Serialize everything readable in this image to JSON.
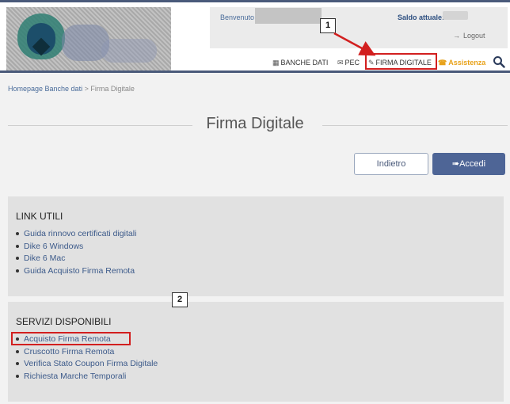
{
  "header": {
    "welcome_label": "Benvenuto",
    "saldo_label": "Saldo attuale:",
    "logout_label": "Logout"
  },
  "nav": {
    "banche_dati": "BANCHE DATI",
    "pec": "PEC",
    "firma_digitale": "FIRMA DIGITALE",
    "assistenza": "Assistenza"
  },
  "callouts": {
    "one": "1",
    "two": "2"
  },
  "breadcrumb": {
    "home": "Homepage Banche dati",
    "separator": ">",
    "current": "Firma Digitale"
  },
  "page": {
    "title": "Firma Digitale"
  },
  "buttons": {
    "back": "Indietro",
    "login": "Accedi"
  },
  "link_utili": {
    "title": "LINK UTILI",
    "items": [
      "Guida rinnovo certificati digitali",
      "Dike 6 Windows",
      "Dike 6 Mac",
      "Guida Acquisto Firma Remota"
    ]
  },
  "servizi": {
    "title": "SERVIZI DISPONIBILI",
    "items": [
      "Acquisto Firma Remota",
      "Cruscotto Firma Remota",
      "Verifica Stato Coupon Firma Digitale",
      "Richiesta Marche Temporali"
    ]
  },
  "colors": {
    "highlight": "#d21f1f",
    "accent": "#4e6596",
    "assist": "#e8a21a"
  }
}
